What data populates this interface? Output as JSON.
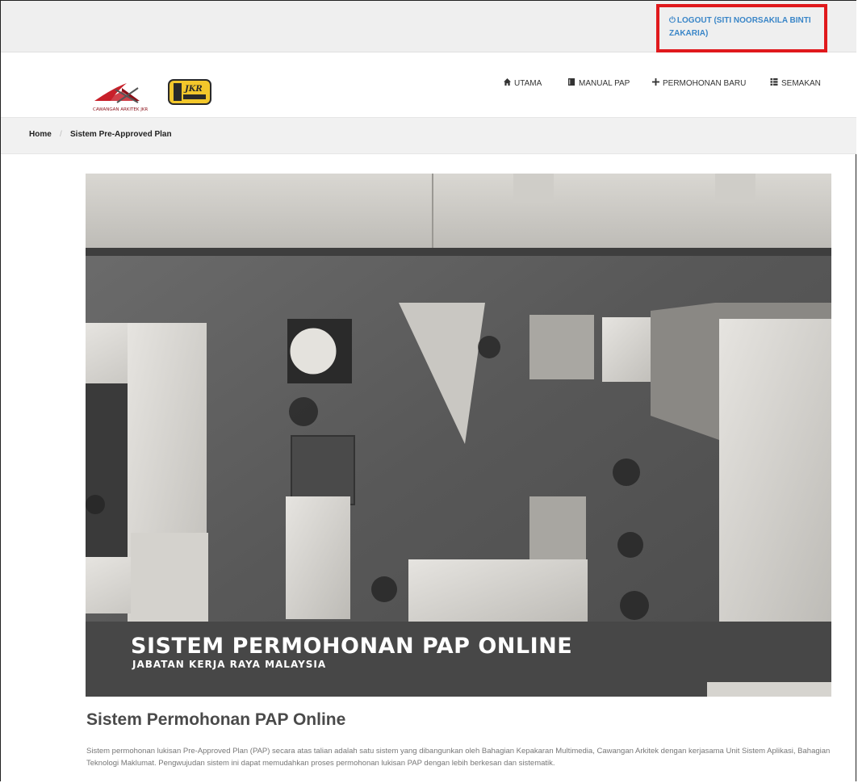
{
  "topbar": {
    "logout_label": "LOGOUT (SITI NOORSAKILA BINTI ZAKARIA)",
    "highlight_color": "#e0191c",
    "link_color": "#3a86c8"
  },
  "header": {
    "logo_text_jkr": "JKR",
    "logo_text_cawangan": "CAWANGAN ARKITEK JKR"
  },
  "nav": [
    {
      "label": "UTAMA",
      "icon": "home-icon"
    },
    {
      "label": "MANUAL PAP",
      "icon": "book-icon"
    },
    {
      "label": "PERMOHONAN BARU",
      "icon": "plus-icon"
    },
    {
      "label": "SEMAKAN",
      "icon": "list-icon"
    }
  ],
  "breadcrumb": {
    "home": "Home",
    "separator": "/",
    "current": "Sistem Pre-Approved Plan"
  },
  "hero": {
    "title": "SISTEM PERMOHONAN PAP ONLINE",
    "subtitle": "JABATAN KERJA RAYA MALAYSIA"
  },
  "content": {
    "title": "Sistem Permohonan PAP Online",
    "description": "Sistem permohonan lukisan Pre-Approved Plan (PAP) secara atas talian adalah satu sistem yang dibangunkan oleh Bahagian Kepakaran Multimedia, Cawangan Arkitek dengan kerjasama Unit Sistem Aplikasi, Bahagian Teknologi Maklumat. Pengwujudan sistem ini dapat memudahkan proses permohonan lukisan PAP dengan lebih berkesan dan sistematik."
  }
}
